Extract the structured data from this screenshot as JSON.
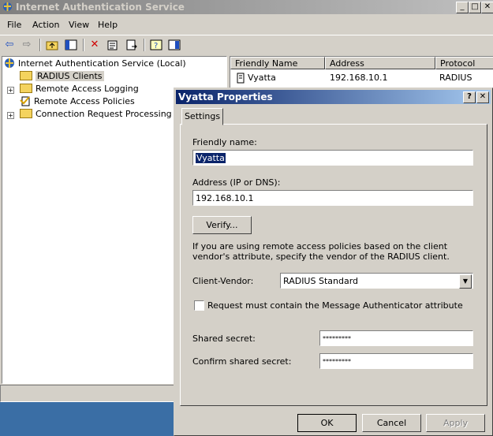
{
  "main_window": {
    "title": "Internet Authentication Service",
    "caption_buttons": {
      "minimize": "_",
      "maximize": "□",
      "close": "✕"
    }
  },
  "menu": {
    "items": [
      "File",
      "Action",
      "View",
      "Help"
    ]
  },
  "toolbar": {
    "icons": [
      "back-icon",
      "forward-icon",
      "up-folder-icon",
      "show-hide-tree-icon",
      "delete-icon",
      "properties-icon",
      "export-list-icon",
      "help-icon",
      "console-icon"
    ]
  },
  "tree": {
    "root": "Internet Authentication Service (Local)",
    "items": [
      {
        "label": "RADIUS Clients",
        "selected": true
      },
      {
        "label": "Remote Access Logging"
      },
      {
        "label": "Remote Access Policies"
      },
      {
        "label": "Connection Request Processing"
      }
    ]
  },
  "list": {
    "columns": [
      "Friendly Name",
      "Address",
      "Protocol"
    ],
    "rows": [
      {
        "name": "Vyatta",
        "address": "192.168.10.1",
        "protocol": "RADIUS"
      }
    ]
  },
  "dialog": {
    "title": "Vyatta Properties",
    "help_button": "?",
    "close_button": "✕",
    "tab": "Settings",
    "friendly_name_label": "Friendly name:",
    "friendly_name_value": "Vyatta",
    "address_label": "Address (IP or DNS):",
    "address_value": "192.168.10.1",
    "verify_button": "Verify...",
    "vendor_info": "If you are using remote access policies based on the client vendor's attribute, specify the vendor of the RADIUS client.",
    "client_vendor_label": "Client-Vendor:",
    "client_vendor_value": "RADIUS Standard",
    "message_auth_label": "Request must contain the Message Authenticator attribute",
    "message_auth_checked": false,
    "shared_secret_label": "Shared secret:",
    "shared_secret_value": "*********",
    "confirm_secret_label": "Confirm shared secret:",
    "confirm_secret_value": "*********",
    "ok_button": "OK",
    "cancel_button": "Cancel",
    "apply_button": "Apply"
  }
}
